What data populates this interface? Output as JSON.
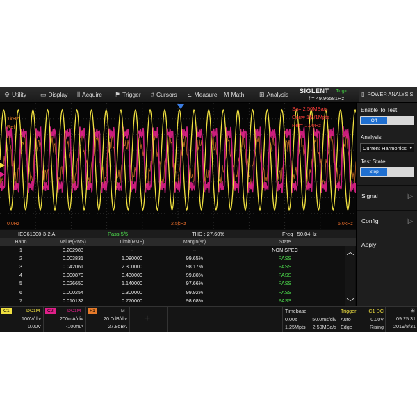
{
  "menu": [
    {
      "icon": "utility-icon",
      "glyph": "⚙",
      "label": "Utility"
    },
    {
      "icon": "display-icon",
      "glyph": "▭",
      "label": "Display"
    },
    {
      "icon": "acquire-icon",
      "glyph": "⫼",
      "label": "Acquire"
    },
    {
      "icon": "trigger-icon",
      "glyph": "⚑",
      "label": "Trigger"
    },
    {
      "icon": "cursors-icon",
      "glyph": "#",
      "label": "Cursors"
    },
    {
      "icon": "measure-icon",
      "glyph": "⊾",
      "label": "Measure"
    },
    {
      "icon": "math-icon",
      "glyph": "M",
      "label": "Math"
    },
    {
      "icon": "analysis-icon",
      "glyph": "⊞",
      "label": "Analysis"
    }
  ],
  "brand": {
    "name": "SIGLENT",
    "trig_status": "Trig'd",
    "freq": "f = 49.96581Hz"
  },
  "panel": {
    "title": "POWER ANALYSIS",
    "enable_test_label": "Enable To Test",
    "enable_test_value": "Off",
    "analysis_label": "Analysis",
    "analysis_value": "Current Harmonics",
    "test_state_label": "Test State",
    "test_state_value": "Stop",
    "signal_label": "Signal",
    "config_label": "Config",
    "apply_label": "Apply"
  },
  "wave": {
    "top_labels": [
      "Sa= 2.50MSa/s",
      "Curr= 1M/1Mpts",
      "Ref= 1.00Hz"
    ],
    "left_labels": [
      "1kHz",
      "Ref"
    ],
    "x_labels": [
      "0.0Hz",
      "2.5kHz",
      "5.0kHz"
    ]
  },
  "results": {
    "standard": "IEC61000-3-2 A",
    "pass_summary": "Pass:5/5",
    "thd": "THD : 27.60%",
    "freq": "Freq : 50.04Hz",
    "columns": [
      "Harm",
      "Value(RMS)",
      "Limit(RMS)",
      "Margin(%)",
      "State"
    ],
    "rows": [
      {
        "harm": "1",
        "value": "0.202983",
        "limit": "--",
        "margin": "--",
        "state": "NON SPEC"
      },
      {
        "harm": "2",
        "value": "0.003831",
        "limit": "1.080000",
        "margin": "99.65%",
        "state": "PASS"
      },
      {
        "harm": "3",
        "value": "0.042061",
        "limit": "2.300000",
        "margin": "98.17%",
        "state": "PASS"
      },
      {
        "harm": "4",
        "value": "0.000870",
        "limit": "0.430000",
        "margin": "99.80%",
        "state": "PASS"
      },
      {
        "harm": "5",
        "value": "0.026650",
        "limit": "1.140000",
        "margin": "97.66%",
        "state": "PASS"
      },
      {
        "harm": "6",
        "value": "0.000254",
        "limit": "0.300000",
        "margin": "99.92%",
        "state": "PASS"
      },
      {
        "harm": "7",
        "value": "0.010132",
        "limit": "0.770000",
        "margin": "98.68%",
        "state": "PASS"
      }
    ]
  },
  "status": {
    "c1": {
      "tag": "C1",
      "coupling": "DC1M",
      "scale": "100V/div",
      "offset": "0.00V",
      "color": "#f0e040"
    },
    "c2": {
      "tag": "C2",
      "coupling": "DC1M",
      "scale": "200mA/div",
      "offset": "-100mA",
      "color": "#e0208a"
    },
    "f1": {
      "tag": "F1",
      "coupling": "M",
      "scale": "20.0dB/div",
      "offset": "27.8dBA",
      "color": "#e57a2a"
    },
    "timebase": {
      "label": "Timebase",
      "delay": "0.00s",
      "tdiv": "50.0ms/div",
      "mem": "1.25Mpts",
      "srate": "2.50MSa/s"
    },
    "trigger": {
      "label": "Trigger",
      "source": "C1 DC",
      "mode": "Auto",
      "level": "0.00V",
      "type": "Edge",
      "slope": "Rising"
    },
    "clock": {
      "time": "09:25:31",
      "date": "2019/8/31"
    }
  },
  "colors": {
    "ch1": "#f0e040",
    "ch2": "#e0208a",
    "math": "#e57a2a",
    "pass": "#4ee04e",
    "accent": "#1f6fd0"
  }
}
